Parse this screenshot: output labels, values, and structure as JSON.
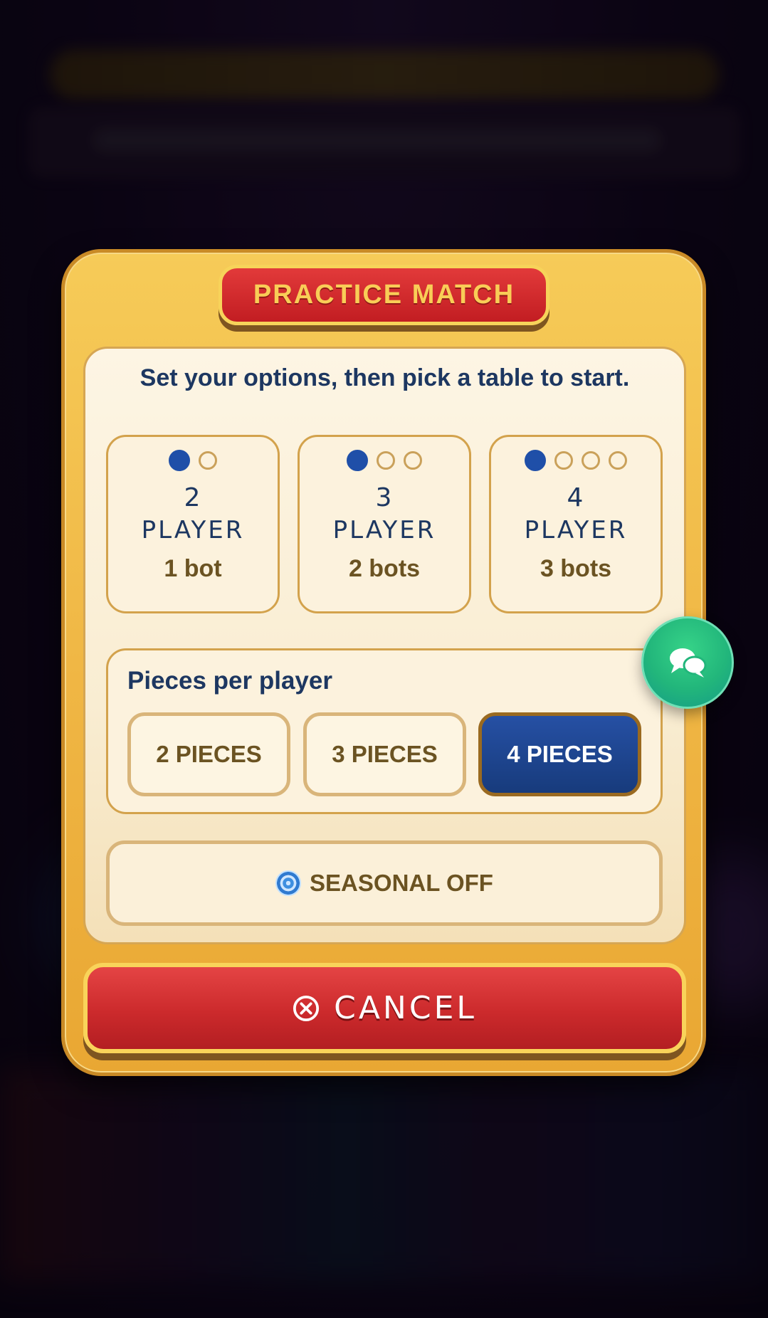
{
  "modal": {
    "title": "PRACTICE MATCH",
    "subtitle": "Set your options, then pick a table to start."
  },
  "modes": [
    {
      "count": "2",
      "word": "PLAYER",
      "bots": "1 bot",
      "seats": 2
    },
    {
      "count": "3",
      "word": "PLAYER",
      "bots": "2 bots",
      "seats": 3
    },
    {
      "count": "4",
      "word": "PLAYER",
      "bots": "3 bots",
      "seats": 4
    }
  ],
  "pieces": {
    "label": "Pieces per player",
    "options": [
      "2 PIECES",
      "3 PIECES",
      "4 PIECES"
    ],
    "selected": "4 PIECES"
  },
  "seasonal": {
    "label": "SEASONAL OFF",
    "icon": "spiral-icon"
  },
  "cancel": {
    "label": "CANCEL",
    "icon": "close-circle-icon"
  },
  "chat": {
    "icon": "chat-bubbles-icon"
  },
  "colors": {
    "accent_blue": "#1f4fa8",
    "title_red": "#c21d22",
    "gold": "#f0b745",
    "chat_green": "#22b67b"
  }
}
